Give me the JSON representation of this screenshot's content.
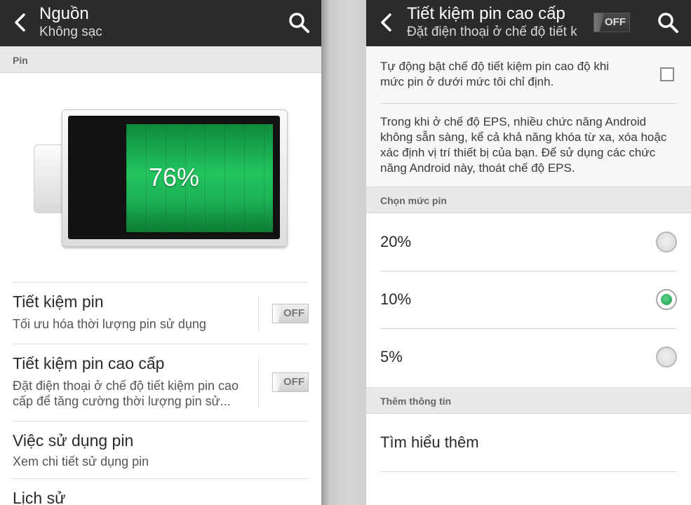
{
  "left_screen": {
    "appbar": {
      "title": "Nguồn",
      "subtitle": "Không sạc",
      "back_icon": "back-chevron-icon",
      "search_icon": "search-icon"
    },
    "section_header": "Pin",
    "battery": {
      "percent_text": "76%",
      "level": 0.76,
      "fill_color": "#22c45f"
    },
    "rows": [
      {
        "title": "Tiết kiệm pin",
        "subtitle": "Tối ưu hóa thời lượng pin sử dụng",
        "toggle": "OFF"
      },
      {
        "title": "Tiết kiệm pin cao cấp",
        "subtitle": "Đặt điện thoại ở chế độ tiết kiệm pin cao cấp để tăng cường thời lượng pin sử...",
        "toggle": "OFF"
      },
      {
        "title": "Việc sử dụng pin",
        "subtitle": "Xem chi tiết sử dụng pin"
      },
      {
        "title": "Lịch sử"
      }
    ]
  },
  "right_screen": {
    "appbar": {
      "title": "Tiết kiệm pin cao cấp",
      "subtitle": "Đặt điện thoại ở chế độ tiết k",
      "toggle": "OFF",
      "back_icon": "back-chevron-icon",
      "search_icon": "search-icon"
    },
    "auto_enable": {
      "text": "Tự động bật chế độ tiết kiệm pin cao độ khi mức pin ở dưới mức tôi chỉ định.",
      "checked": false
    },
    "info_text": "Trong khi ở chế độ EPS, nhiều chức năng Android không sẵn sàng, kể cả khả năng khóa từ xa, xóa hoặc xác định vị trí thiết bị của bạn. Để sử dụng các chức năng Android này, thoát chế độ EPS.",
    "level_header": "Chọn mức pin",
    "levels": [
      {
        "label": "20%",
        "selected": false
      },
      {
        "label": "10%",
        "selected": true
      },
      {
        "label": "5%",
        "selected": false
      }
    ],
    "more_header": "Thêm thông tin",
    "learn_more": "Tìm hiểu thêm"
  },
  "colors": {
    "appbar_bg": "#2b2b2b",
    "accent_green": "#1f9a4e",
    "section_bg": "#e8e8e8"
  }
}
